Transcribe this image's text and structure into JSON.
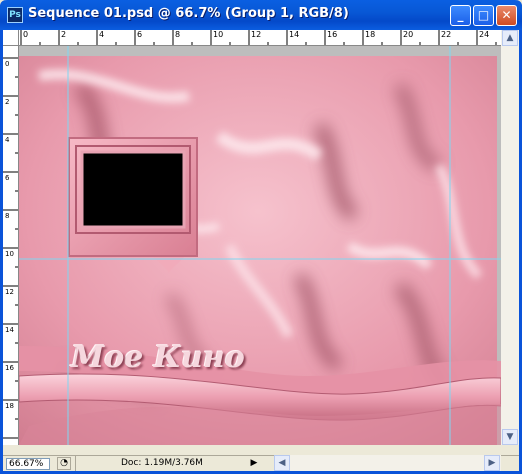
{
  "window": {
    "title": "Sequence 01.psd @ 66.7% (Group 1, RGB/8)",
    "icon_text": "Ps",
    "minimize_label": "_",
    "maximize_label": "□",
    "close_label": "✕"
  },
  "rulers": {
    "top_ticks": [
      "0",
      "2",
      "4",
      "6",
      "8",
      "10",
      "12",
      "14",
      "16",
      "18",
      "20",
      "22",
      "24"
    ],
    "left_ticks": [
      "0",
      "2",
      "4",
      "6",
      "8",
      "10",
      "12",
      "14",
      "16",
      "18"
    ]
  },
  "canvas": {
    "title_text": "Мое Кино",
    "background_color": "#e79aab",
    "guide_color": "#7fd7f2"
  },
  "status": {
    "zoom": "66.67%",
    "doc": "Doc: 1.19M/3.76M",
    "menu_arrow": "▶"
  },
  "scrollbars": {
    "up": "▲",
    "down": "▼",
    "left": "◀",
    "right": "▶"
  }
}
